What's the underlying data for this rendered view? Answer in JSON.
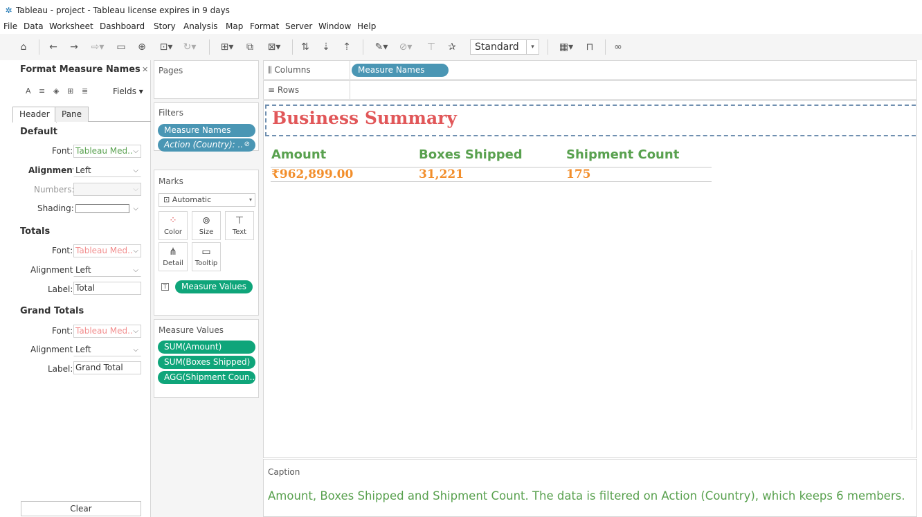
{
  "window": {
    "title": "Tableau - project - Tableau license expires in 9 days"
  },
  "menu": [
    "File",
    "Data",
    "Worksheet",
    "Dashboard",
    "Story",
    "Analysis",
    "Map",
    "Format",
    "Server",
    "Window",
    "Help"
  ],
  "toolbar": {
    "fit_select": "Standard"
  },
  "format_panel": {
    "title": "Format Measure Names",
    "fields_label": "Fields",
    "tabs": [
      "Header",
      "Pane"
    ],
    "default": {
      "heading": "Default",
      "font_label": "Font:",
      "font_value": "Tableau Med..",
      "alignment_label": "Alignment:",
      "alignment_value": "Left",
      "numbers_label": "Numbers:",
      "shading_label": "Shading:"
    },
    "totals": {
      "heading": "Totals",
      "font_label": "Font:",
      "font_value": "Tableau Med..",
      "alignment_label": "Alignment:",
      "alignment_value": "Left",
      "label_label": "Label:",
      "label_value": "Total"
    },
    "grand_totals": {
      "heading": "Grand Totals",
      "font_label": "Font:",
      "font_value": "Tableau Med..",
      "alignment_label": "Alignment:",
      "alignment_value": "Left",
      "label_label": "Label:",
      "label_value": "Grand Total"
    },
    "clear_label": "Clear"
  },
  "pages": {
    "title": "Pages"
  },
  "filters": {
    "title": "Filters",
    "pills": [
      "Measure Names",
      "Action (Country): .."
    ]
  },
  "marks": {
    "title": "Marks",
    "type": "Automatic",
    "buttons": [
      "Color",
      "Size",
      "Text",
      "Detail",
      "Tooltip"
    ],
    "text_pill": "Measure Values"
  },
  "measure_values": {
    "title": "Measure Values",
    "pills": [
      "SUM(Amount)",
      "SUM(Boxes Shipped)",
      "AGG(Shipment Coun.."
    ]
  },
  "shelves": {
    "columns_label": "Columns",
    "columns_pill": "Measure Names",
    "rows_label": "Rows"
  },
  "viz": {
    "title": "Business Summary",
    "headers": [
      "Amount",
      "Boxes Shipped",
      "Shipment Count"
    ],
    "values": [
      "₹962,899.00",
      "31,221",
      "175"
    ]
  },
  "caption": {
    "title": "Caption",
    "text": "Amount, Boxes Shipped and Shipment Count. The data is filtered on Action (Country), which keeps 6 members."
  }
}
